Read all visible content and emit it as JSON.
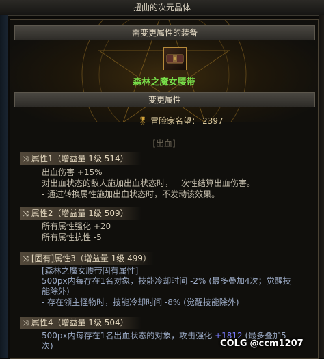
{
  "window": {
    "title": "扭曲的次元晶体"
  },
  "equip_section": {
    "title": "需变更属性的装备"
  },
  "item": {
    "name": "森林之魔女腰带",
    "icon": "belt-icon"
  },
  "change_section": {
    "title": "变更属性"
  },
  "fame": {
    "label": "冒险家名望：",
    "value": "2397",
    "icon": "fame-medal-icon"
  },
  "tag": {
    "text": "[出血]"
  },
  "attributes": [
    {
      "header": "属性1（增益量 1级 514）",
      "lines": [
        "出血伤害 +15%",
        "对出血状态的敌人施加出血状态时，一次性结算出血伤害。",
        "- 通过转换属性施加出血状态时，不发动该效果。"
      ]
    },
    {
      "header": "属性2（增益量 1级 509）",
      "lines": [
        "所有属性强化 +20",
        "所有属性抗性 -5"
      ]
    },
    {
      "header": "[固有]属性3（增益量 1级 499）",
      "lines": [
        "[森林之魔女腰带固有属性]",
        "500px内每存在1名对象，技能冷却时间 -2% (最多叠加4次；觉醒技",
        "能除外)",
        "- 存在领主怪物时，技能冷却时间 -8% (觉醒技能除外)"
      ]
    },
    {
      "header": "属性4（增益量 1级 504）",
      "lines": [
        "500px内每存在1名出血状态的对象，攻击强化 +1812 (最多叠加5",
        "次)"
      ],
      "highlight": "+1812"
    }
  ],
  "watermark": {
    "logo": "COLG",
    "text": "@ccm1207"
  },
  "colors": {
    "item_name": "#78e04a",
    "highlight": "#7a7cff",
    "text": "#c6bfae"
  }
}
